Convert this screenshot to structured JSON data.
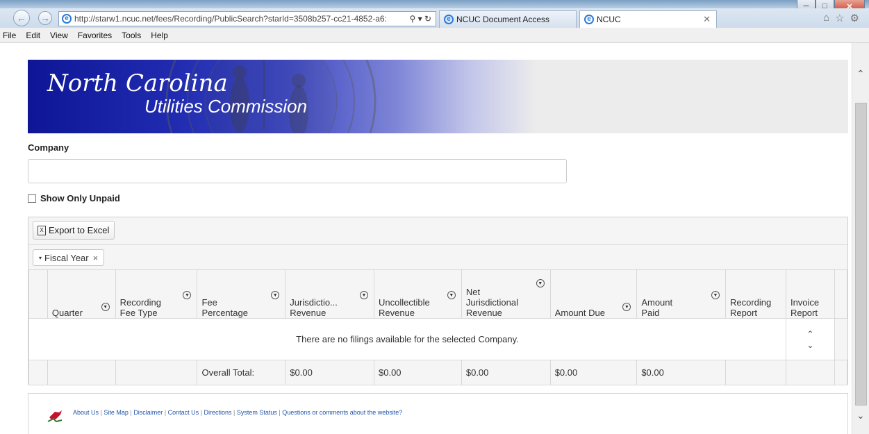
{
  "browser": {
    "url": "http://starw1.ncuc.net/fees/Recording/PublicSearch?starId=3508b257-cc21-4852-a6:",
    "tabs": [
      {
        "label": "NCUC Document Access"
      },
      {
        "label": "NCUC"
      }
    ],
    "menu": [
      "File",
      "Edit",
      "View",
      "Favorites",
      "Tools",
      "Help"
    ]
  },
  "banner": {
    "line1": "North Carolina",
    "line2": "Utilities Commission"
  },
  "form": {
    "company_label": "Company",
    "company_value": "",
    "unpaid_label": "Show Only Unpaid"
  },
  "grid": {
    "export_label": "Export to Excel",
    "group_label": "Fiscal Year",
    "columns": [
      {
        "label": "Quarter",
        "filter": true
      },
      {
        "label": "Recording Fee Type",
        "filter": true
      },
      {
        "label": "Fee Percentage",
        "filter": true
      },
      {
        "label": "Jurisdictio...",
        "label2": "Revenue",
        "filter": true
      },
      {
        "label": "Uncollectible Revenue",
        "filter": true
      },
      {
        "label": "Net Jurisdictional Revenue",
        "filter": true
      },
      {
        "label": "Amount Due",
        "filter": true
      },
      {
        "label": "Amount Paid",
        "filter": true
      },
      {
        "label": "Recording Report",
        "filter": false
      },
      {
        "label": "Invoice Report",
        "filter": false
      }
    ],
    "empty_message": "There are no filings available for the selected Company.",
    "totals": {
      "label": "Overall Total:",
      "jurisdictional": "$0.00",
      "uncollectible": "$0.00",
      "net": "$0.00",
      "amount_due": "$0.00",
      "amount_paid": "$0.00"
    }
  },
  "footer": {
    "links": [
      "About Us",
      "Site Map",
      "Disclaimer",
      "Contact Us",
      "Directions",
      "System Status",
      "Questions or comments about the website?"
    ]
  }
}
